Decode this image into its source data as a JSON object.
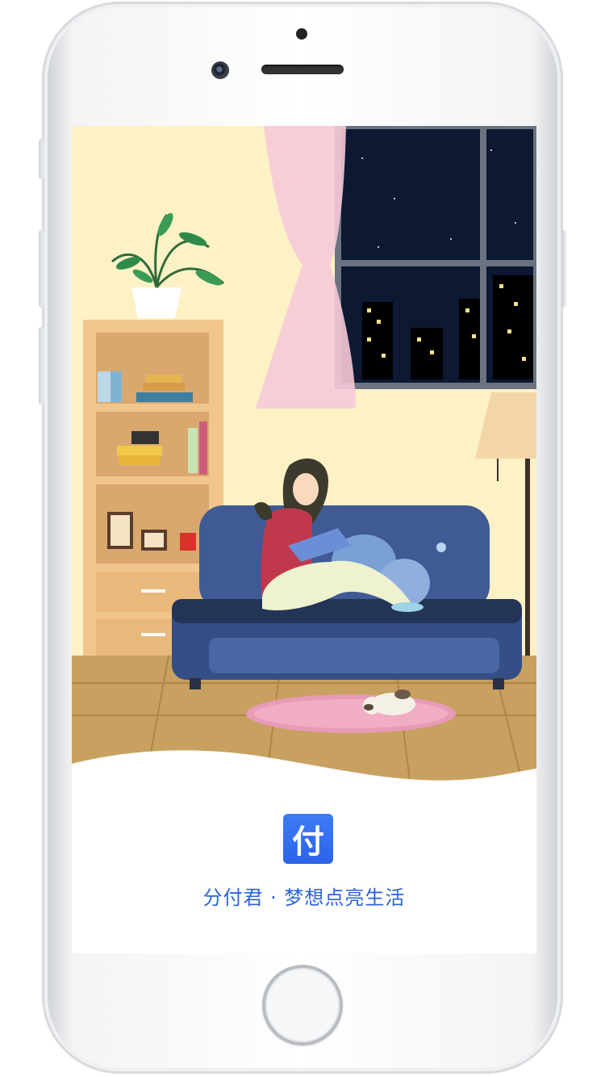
{
  "app": {
    "logo_char": "付",
    "slogan": "分付君 · 梦想点亮生活",
    "brand_color": "#2a63e8",
    "slogan_color": "#2b63d9"
  },
  "illustration": {
    "scene": "night-living-room-reading",
    "colors": {
      "wall": "#fdf1c6",
      "sky": "#0d1833",
      "sofa": "#3f5a94",
      "floor": "#c8a060",
      "rug": "#e79bb7",
      "shelf": "#f1c68c",
      "curtain": "#f6c9d7"
    }
  },
  "device": {
    "frame": "iphone-white"
  }
}
